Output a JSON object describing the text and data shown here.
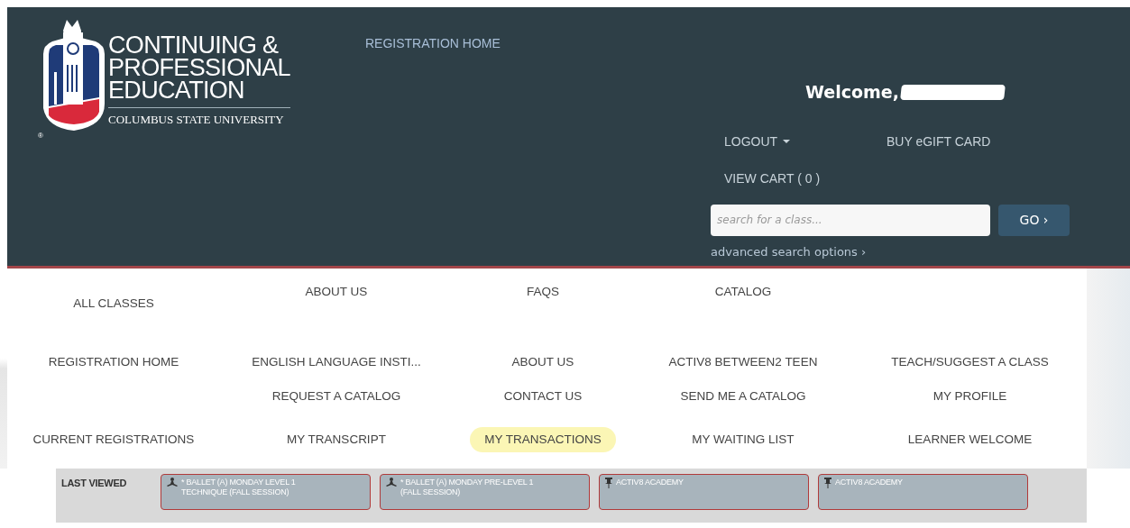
{
  "header": {
    "logo": {
      "lines": [
        "CONTINUING &",
        "PROFESSIONAL",
        "EDUCATION"
      ],
      "university": "COLUMBUS STATE UNIVERSITY",
      "registered": "®"
    },
    "top_link": "REGISTRATION HOME",
    "welcome": "Welcome,",
    "account_links": [
      "LOGOUT",
      "BUY eGIFT CARD",
      "VIEW CART ( 0 )"
    ],
    "search": {
      "placeholder": "search for a class...",
      "button": "GO ›",
      "advanced": "advanced search options ›"
    }
  },
  "menu": {
    "rows": [
      [
        {
          "kind": "link",
          "label": "ALL CLASSES",
          "selected": false
        },
        {
          "kind": "link",
          "label": "ABOUT US",
          "selected": false
        },
        {
          "kind": "link",
          "label": "FAQS",
          "selected": false
        },
        {
          "kind": "link",
          "label": "CATALOG",
          "selected": false
        },
        {
          "kind": "blank"
        }
      ],
      [
        {
          "kind": "link",
          "label": "REGISTRATION HOME",
          "selected": false
        },
        {
          "kind": "link",
          "label": "ENGLISH LANGUAGE INSTI...",
          "selected": false
        },
        {
          "kind": "link",
          "label": "ABOUT US",
          "selected": false
        },
        {
          "kind": "link",
          "label": "ACTIV8 BETWEEN2 TEEN",
          "selected": false
        },
        {
          "kind": "link",
          "label": "TEACH/SUGGEST A CLASS",
          "selected": false
        }
      ],
      [
        {
          "kind": "blank"
        },
        {
          "kind": "link",
          "label": "REQUEST A CATALOG",
          "selected": false
        },
        {
          "kind": "link",
          "label": "CONTACT US",
          "selected": false
        },
        {
          "kind": "link",
          "label": "SEND ME A CATALOG",
          "selected": false
        },
        {
          "kind": "link",
          "label": "MY PROFILE",
          "selected": false
        }
      ],
      [
        {
          "kind": "link",
          "label": "CURRENT REGISTRATIONS",
          "selected": false
        },
        {
          "kind": "link",
          "label": "MY TRANSCRIPT",
          "selected": false
        },
        {
          "kind": "link",
          "label": "MY TRANSACTIONS",
          "selected": true
        },
        {
          "kind": "link",
          "label": "MY WAITING LIST",
          "selected": false
        },
        {
          "kind": "link",
          "label": "LEARNER WELCOME",
          "selected": false
        }
      ]
    ]
  },
  "last_viewed": {
    "label": "LAST VIEWED",
    "items": [
      {
        "kind": "dancer",
        "label": "* BALLET (A) MONDAY LEVEL 1 TECHNIQUE (FALL SESSION)"
      },
      {
        "kind": "dancer",
        "label": "* BALLET (A) MONDAY PRE-LEVEL 1 (FALL SESSION)"
      },
      {
        "kind": "pin",
        "label": "ACTIV8 ACADEMY"
      },
      {
        "kind": "pin",
        "label": "ACTIV8 ACADEMY"
      }
    ]
  }
}
